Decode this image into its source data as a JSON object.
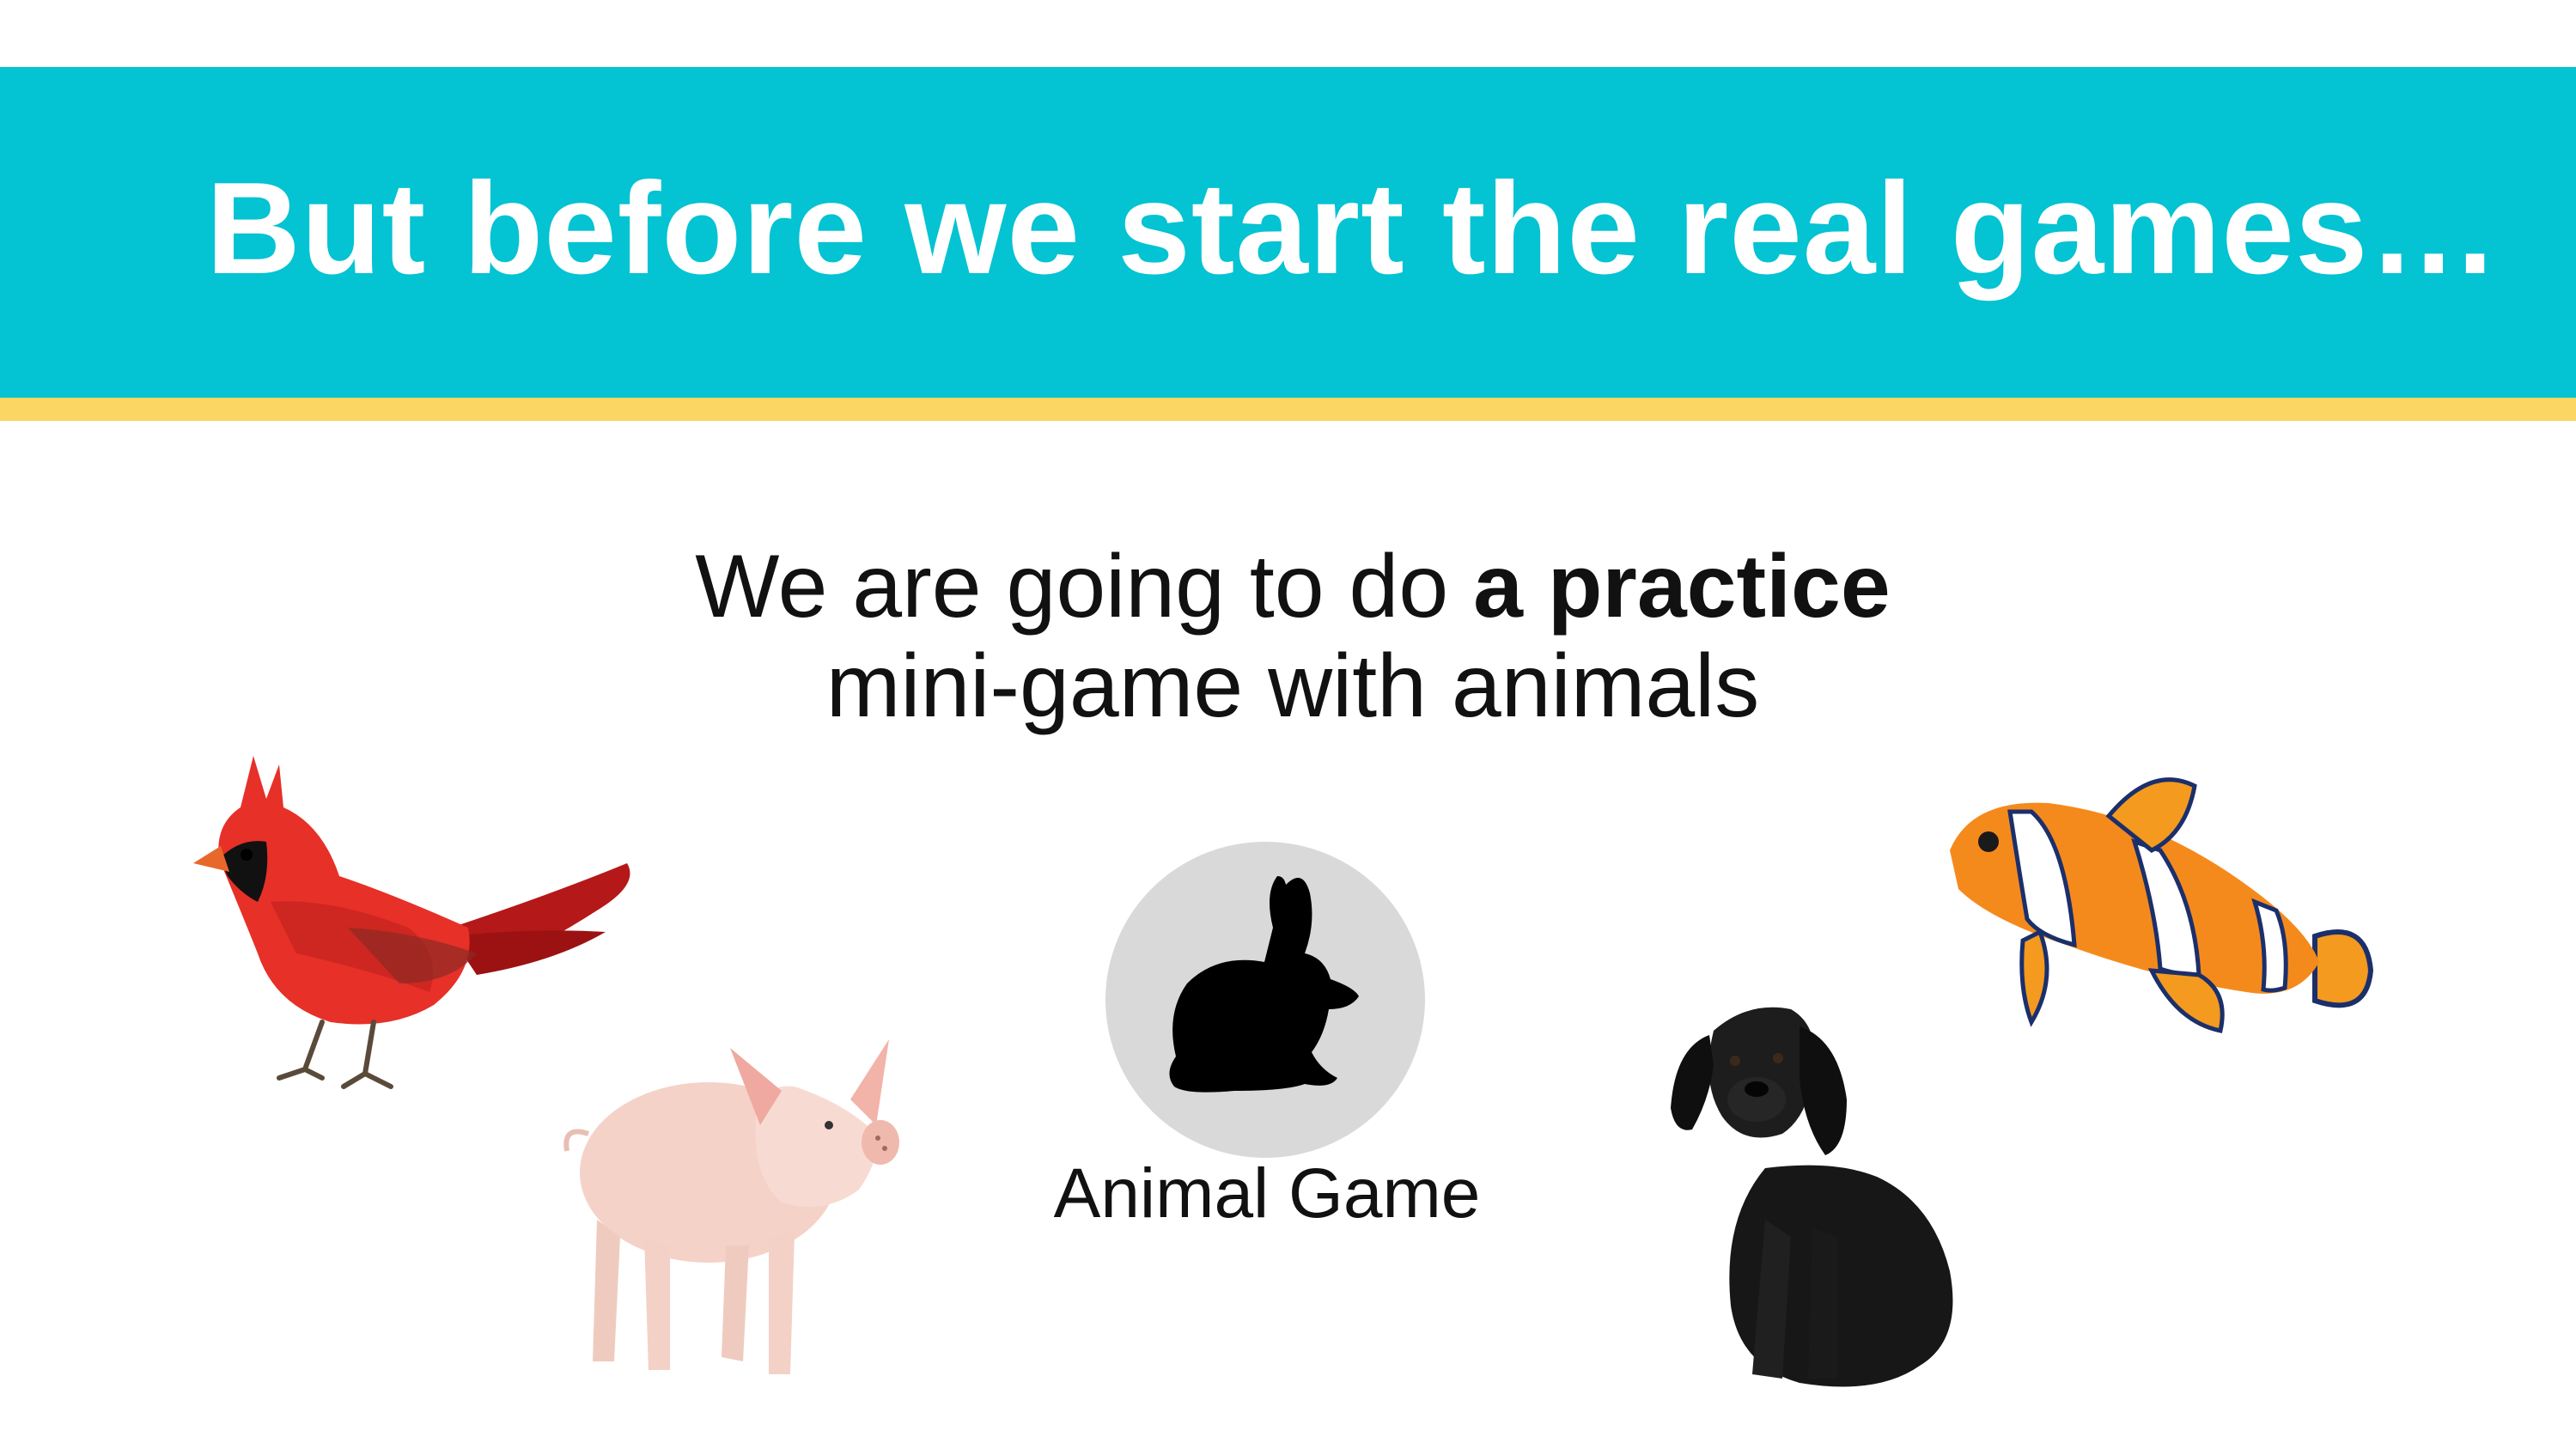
{
  "slide": {
    "title": "But before we start the real games…",
    "subtitle": {
      "line1_plain": "We are going to do ",
      "line1_bold": "a practice",
      "line2": "mini-game with animals"
    },
    "banner_color": "#04c3d2",
    "stripe_color": "#fbd662"
  },
  "game_tile": {
    "label": "Animal Game",
    "icon": "rabbit-silhouette-icon"
  },
  "animals": [
    {
      "name": "cardinal",
      "kind": "bird"
    },
    {
      "name": "pig",
      "kind": "mammal"
    },
    {
      "name": "dog",
      "kind": "mammal"
    },
    {
      "name": "clownfish",
      "kind": "fish"
    }
  ]
}
